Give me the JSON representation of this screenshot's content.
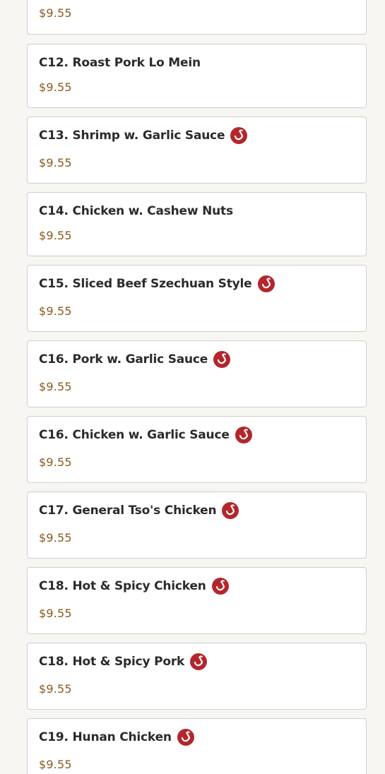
{
  "colors": {
    "background": "#f7f6f3",
    "card_border": "#cfcfcf",
    "title": "#2b2b2b",
    "price": "#8a5a1e",
    "spicy_icon": "#b3262b"
  },
  "menu_items": [
    {
      "name": "",
      "price": "$9.55",
      "spicy": false
    },
    {
      "name": "C12. Roast Pork Lo Mein",
      "price": "$9.55",
      "spicy": false
    },
    {
      "name": "C13. Shrimp w. Garlic Sauce",
      "price": "$9.55",
      "spicy": true
    },
    {
      "name": "C14. Chicken w. Cashew Nuts",
      "price": "$9.55",
      "spicy": false
    },
    {
      "name": "C15. Sliced Beef Szechuan Style",
      "price": "$9.55",
      "spicy": true
    },
    {
      "name": "C16. Pork w. Garlic Sauce",
      "price": "$9.55",
      "spicy": true
    },
    {
      "name": "C16. Chicken w. Garlic Sauce",
      "price": "$9.55",
      "spicy": true
    },
    {
      "name": "C17. General Tso's Chicken",
      "price": "$9.55",
      "spicy": true
    },
    {
      "name": "C18. Hot & Spicy Chicken",
      "price": "$9.55",
      "spicy": true
    },
    {
      "name": "C18. Hot & Spicy Pork",
      "price": "$9.55",
      "spicy": true
    },
    {
      "name": "C19. Hunan Chicken",
      "price": "$9.55",
      "spicy": true
    }
  ]
}
